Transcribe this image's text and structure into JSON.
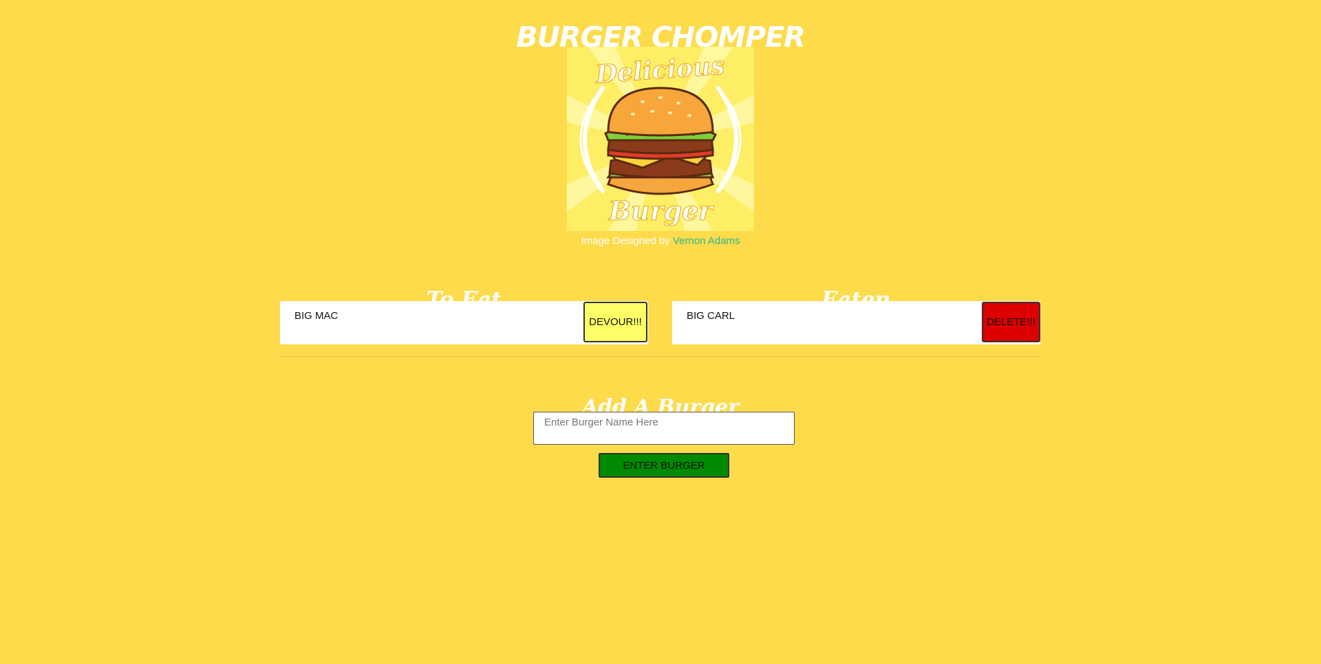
{
  "header": {
    "title": "BURGER CHOMPER"
  },
  "logo": {
    "top_text": "Delicious",
    "bottom_text": "Burger",
    "icon": "burger-icon"
  },
  "credit": {
    "prefix": "Image Designed by",
    "author": "Vernon Adams"
  },
  "to_eat": {
    "heading": "To Eat",
    "items": [
      {
        "name": "BIG MAC",
        "button_label": "DEVOUR!!!"
      }
    ]
  },
  "eaten": {
    "heading": "Eaten",
    "items": [
      {
        "name": "BIG CARL",
        "button_label": "DELETE!!!"
      }
    ]
  },
  "add_burger": {
    "heading": "Add A Burger",
    "placeholder": "Enter Burger Name Here",
    "value": "",
    "submit_label": "ENTER BURGER"
  },
  "colors": {
    "background": "#fedb4b",
    "devour_button": "#ffff66",
    "delete_button": "#dd0000",
    "enter_button": "#008a00",
    "link": "#2ab88f"
  }
}
